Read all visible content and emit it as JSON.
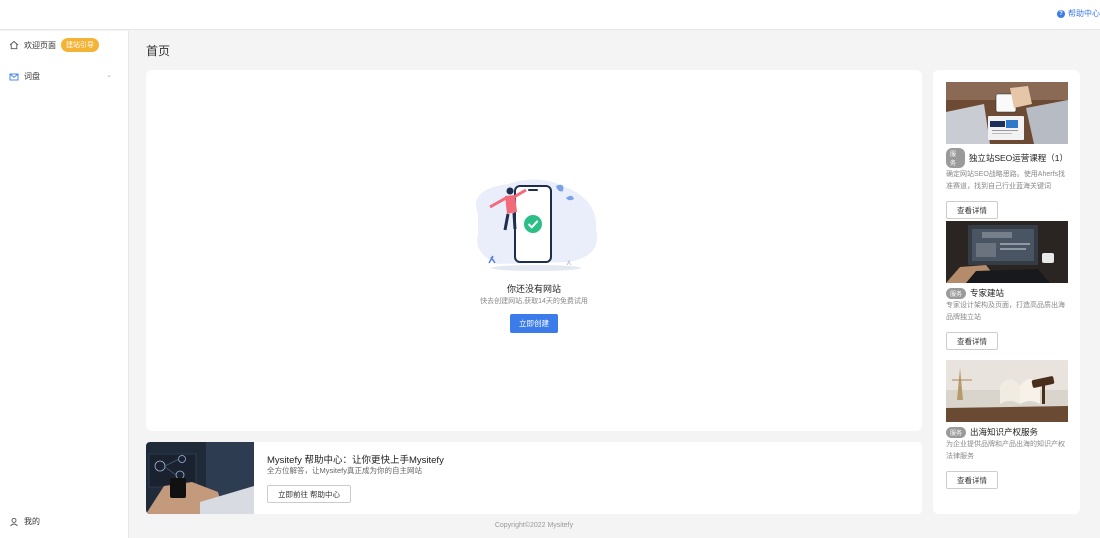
{
  "topbar": {
    "help_label": "帮助中心",
    "help_icon": "help-circle-icon"
  },
  "sidebar": {
    "items": [
      {
        "label": "欢迎页面",
        "badge": "建站引导",
        "icon": "home-icon"
      },
      {
        "label": "词盘",
        "icon": "mail-icon",
        "expand_icon": "chevron-down-icon"
      }
    ],
    "bottom": {
      "label": "我的",
      "icon": "user-icon"
    }
  },
  "page_title": "首页",
  "empty_state": {
    "title": "你还没有网站",
    "subtitle": "快去创建网站,获取14天的免费试用",
    "button": "立即创建"
  },
  "help_banner": {
    "title": "Mysitefy 帮助中心：让你更快上手Mysitefy",
    "subtitle": "全方位解答，让Mysitefy真正成为你的自主网站",
    "button": "立即前往 帮助中心"
  },
  "services": [
    {
      "tag": "服务",
      "title": "独立站SEO运营课程（1）",
      "desc": "确定网站SEO战略思路。使用Aherfs找准赛道，找到自己行业蓝海关键词",
      "button": "查看详情"
    },
    {
      "tag": "服务",
      "title": "专家建站",
      "desc": "专家设计架构及页面，打造高品质出海品牌独立站",
      "button": "查看详情"
    },
    {
      "tag": "服务",
      "title": "出海知识产权服务",
      "desc": "为企业提供品牌和产品出海的知识产权法律服务",
      "button": "查看详情"
    }
  ],
  "footer": "Copyright©2022  Mysitefy",
  "colors": {
    "accent": "#3b7bea",
    "badge": "#f5b335",
    "success": "#2bbf85",
    "illustration_person": "#f26b7a"
  }
}
